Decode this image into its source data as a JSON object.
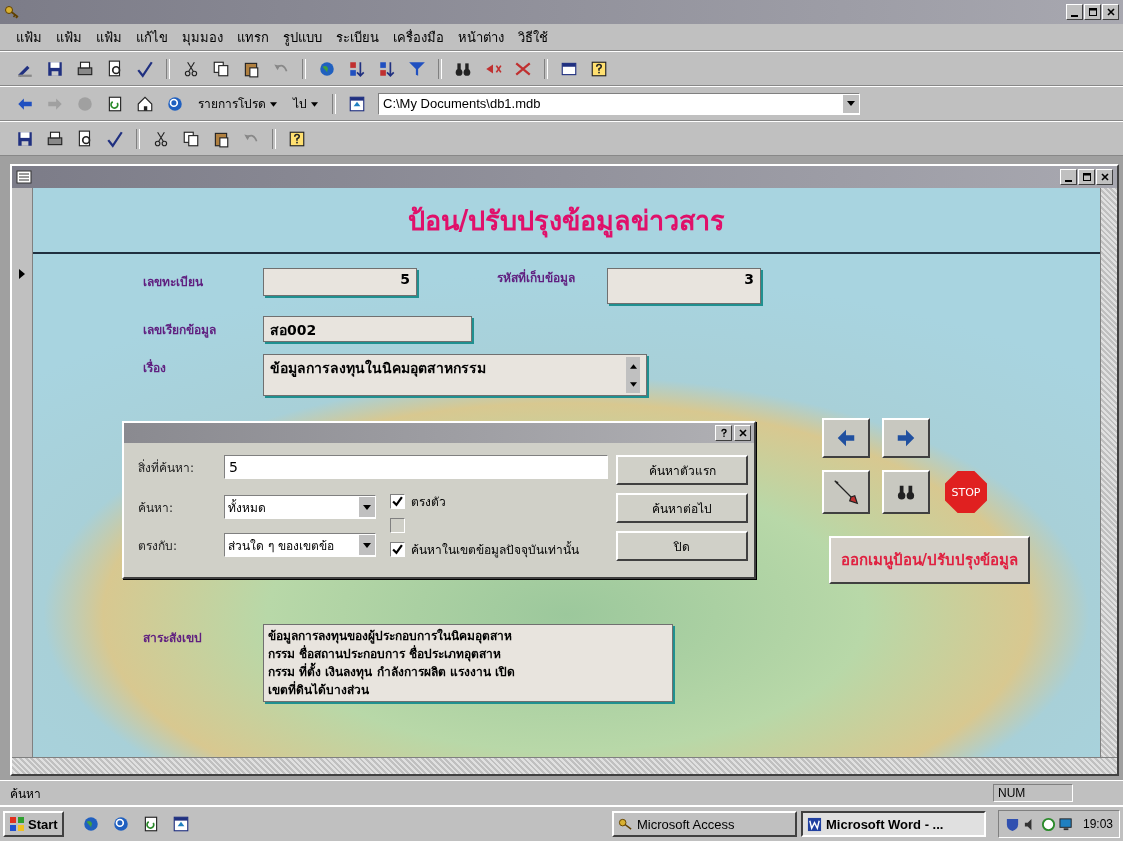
{
  "menu": [
    "แฟ้ม",
    "แฟ้ม",
    "แฟ้ม",
    "แก้ไข",
    "มุมมอง",
    "แทรก",
    "รูปแบบ",
    "ระเบียน",
    "เครื่องมือ",
    "หน้าต่าง",
    "วิธีใช้"
  ],
  "web_toolbar": {
    "favorites": "รายการโปรด",
    "go": "ไป",
    "address": "C:\\My Documents\\db1.mdb"
  },
  "form": {
    "heading": "ป้อน/ปรับปรุงข้อมูลข่าวสาร",
    "fields": [
      {
        "label": "เลขทะเบียน",
        "value": "5",
        "kind": "number"
      },
      {
        "label": "รหัสที่เก็บข้อมูล",
        "value": "3",
        "kind": "number"
      },
      {
        "label": "เลขเรียกข้อมูล",
        "value": "สอ002",
        "kind": "text"
      },
      {
        "label": "เรื่อง",
        "value": "ข้อมูลการลงทุนในนิคมอุตสาหกรรม",
        "kind": "memo"
      }
    ],
    "stop_label": "STOP",
    "exit_button": "ออกเมนูป้อน/ปรับปรุงข้อมูล",
    "abstract": {
      "label": "สาระสังเขป",
      "lines": [
        "ข้อมูลการลงทุนของผู้ประกอบการในนิคมอุตสาห",
        "กรรม ชื่อสถานประกอบการ ชื่อประเภทอุตสาห",
        "กรรม ที่ตั้ง เงินลงทุน กำลังการผลิต แรงงาน เปิด",
        "เขตที่ดินได้บางส่วน"
      ]
    }
  },
  "find_dialog": {
    "find_label": "สิ่งที่ค้นหา:",
    "find_value": "5",
    "search_label": "ค้นหา:",
    "search_value": "ทั้งหมด",
    "match_label": "ตรงกับ:",
    "match_value": "ส่วนใด ๆ ของเขตข้อ",
    "checkboxes": [
      {
        "label": "ตรงตัว",
        "checked": true,
        "disabled": false
      },
      {
        "checked": false,
        "disabled": true
      },
      {
        "label": "ค้นหาในเขตข้อมูลปัจจุบันเท่านั้น",
        "checked": true,
        "disabled": false
      }
    ],
    "buttons": [
      "ค้นหาตัวแรก",
      "ค้นหาต่อไป",
      "ปิด"
    ]
  },
  "status_bar": {
    "text": "ค้นหา",
    "indicator": "NUM"
  },
  "taskbar": {
    "start": "Start",
    "tasks": [
      {
        "label": "Microsoft Access",
        "selected": false
      },
      {
        "label": "Microsoft Word - ...",
        "selected": true
      }
    ],
    "clock": "19:03"
  }
}
